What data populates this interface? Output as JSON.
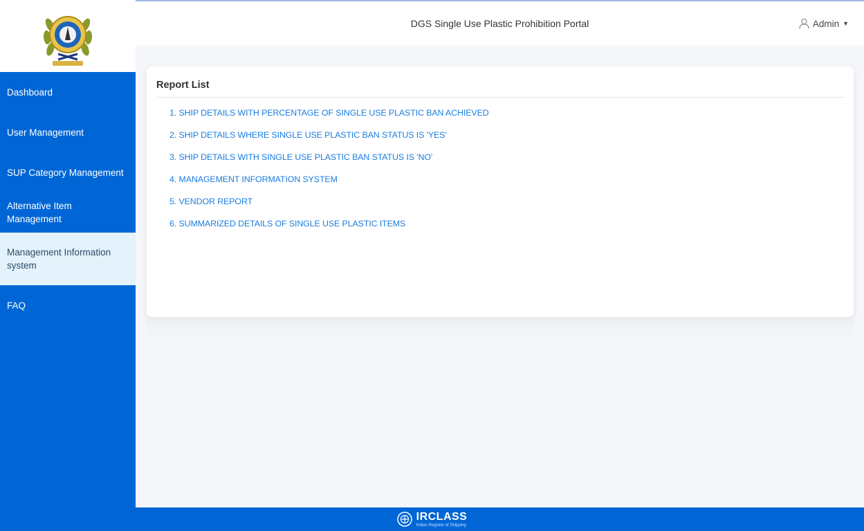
{
  "header": {
    "title": "DGS Single Use Plastic Prohibition Portal",
    "user_label": "Admin"
  },
  "sidebar": {
    "logo_icon": "dgs-emblem-logo",
    "items": [
      {
        "label": "Dashboard",
        "active": false
      },
      {
        "label": "User Management",
        "active": false
      },
      {
        "label": "SUP Category Management",
        "active": false
      },
      {
        "label": "Alternative Item Management",
        "active": false
      },
      {
        "label": "Management Information system",
        "active": true
      },
      {
        "label": "FAQ",
        "active": false
      }
    ]
  },
  "main": {
    "card_title": "Report List",
    "reports": [
      "1. SHIP DETAILS WITH PERCENTAGE OF SINGLE USE PLASTIC BAN ACHIEVED",
      "2. SHIP DETAILS WHERE SINGLE USE PLASTIC BAN STATUS IS 'YES'",
      "3. SHIP DETAILS WITH SINGLE USE PLASTIC BAN STATUS IS 'NO'",
      "4. MANAGEMENT INFORMATION SYSTEM",
      "5. VENDOR REPORT",
      "6. SUMMARIZED DETAILS OF SINGLE USE PLASTIC ITEMS"
    ]
  },
  "footer": {
    "brand": "IRCLASS",
    "tagline": "Indian Register of Shipping"
  },
  "colors": {
    "sidebar": "#0066d6",
    "active_item": "#e3f2fb",
    "link": "#1a7de0",
    "background": "#f4f6f9"
  }
}
